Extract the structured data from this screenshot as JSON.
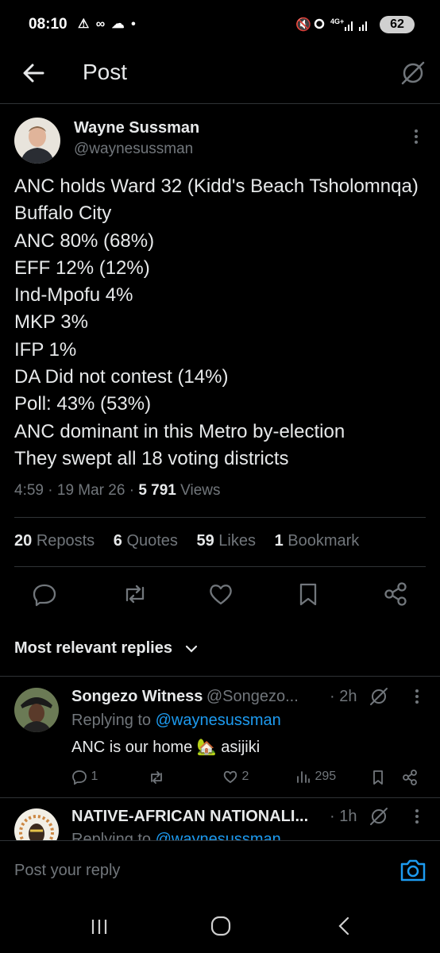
{
  "status_bar": {
    "time": "08:10",
    "left_icons": "⚠ ∞ ☁ •",
    "network": "4G+",
    "battery": "62"
  },
  "header": {
    "title": "Post"
  },
  "tweet": {
    "author_name": "Wayne Sussman",
    "author_handle": "@waynesussman",
    "text": "ANC holds Ward 32 (Kidd's Beach Tsholomnqa) Buffalo City\nANC 80% (68%)\nEFF 12% (12%)\nInd-Mpofu 4%\nMKP 3%\nIFP 1%\nDA Did not contest (14%)\nPoll: 43% (53%)\nANC dominant in this Metro by-election\nThey swept all 18 voting districts",
    "time": "4:59",
    "date": "19 Mar 26",
    "views_count": "5 791",
    "views_label": "Views",
    "separator": "·"
  },
  "stats": {
    "reposts_count": "20",
    "reposts_label": "Reposts",
    "quotes_count": "6",
    "quotes_label": "Quotes",
    "likes_count": "59",
    "likes_label": "Likes",
    "bookmarks_count": "1",
    "bookmarks_label": "Bookmark"
  },
  "replies_sort": {
    "label": "Most relevant replies"
  },
  "replies": [
    {
      "name": "Songezo Witness",
      "handle": "@Songezo...",
      "time": "· 2h",
      "replying_prefix": "Replying to",
      "replying_handle": "@waynesussman",
      "text": "ANC is our home 🏡 asijiki",
      "replies": "1",
      "likes": "2",
      "views": "295"
    },
    {
      "name": "NATIVE-AFRICAN NATIONALI...",
      "time": "· 1h",
      "replying_prefix": "Replying to",
      "replying_handle": "@waynesussman"
    }
  ],
  "composer": {
    "placeholder": "Post your reply"
  },
  "colors": {
    "accent": "#1d9bf0",
    "muted": "#71767b",
    "text": "#e7e9ea",
    "background": "#000000"
  }
}
